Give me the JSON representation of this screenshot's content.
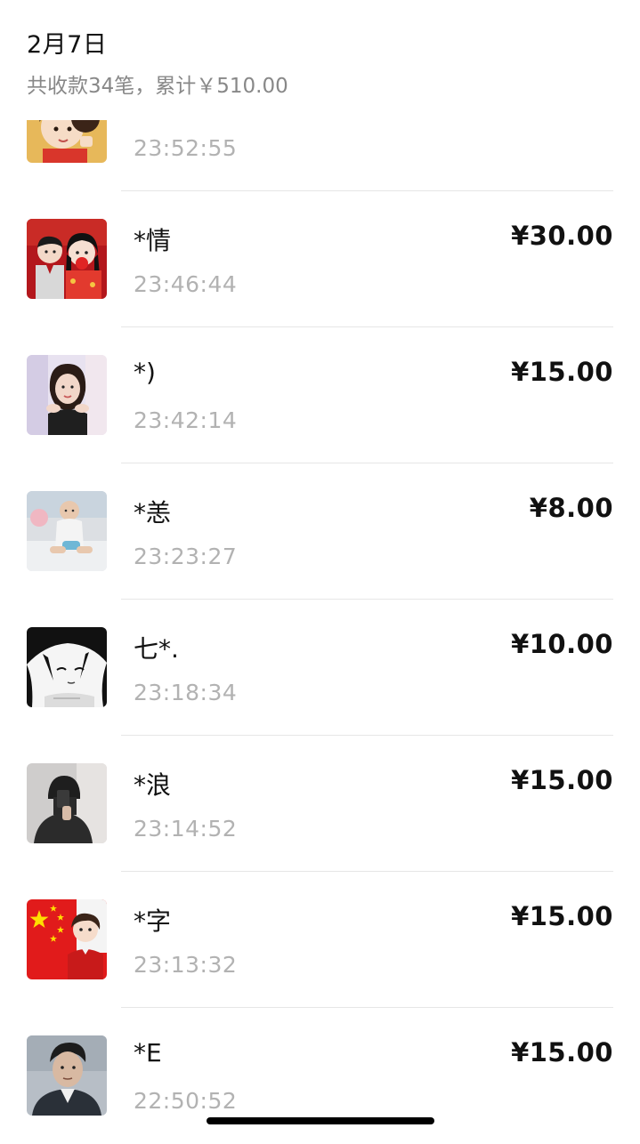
{
  "header": {
    "date": "2月7日",
    "summary": "共收款34笔，累计￥510.00"
  },
  "transactions": [
    {
      "name": "",
      "time": "23:52:55",
      "amount": "",
      "avatar": "cartoon-girl-avatar"
    },
    {
      "name": "*情",
      "time": "23:46:44",
      "amount": "¥30.00",
      "avatar": "wedding-couple-avatar"
    },
    {
      "name": "*)",
      "time": "23:42:14",
      "amount": "¥15.00",
      "avatar": "woman-portrait-avatar"
    },
    {
      "name": "*恙",
      "time": "23:23:27",
      "amount": "¥8.00",
      "avatar": "baby-photo-avatar"
    },
    {
      "name": "七*.",
      "time": "23:18:34",
      "amount": "¥10.00",
      "avatar": "manga-girl-avatar"
    },
    {
      "name": "*浪",
      "time": "23:14:52",
      "amount": "¥15.00",
      "avatar": "hooded-man-avatar"
    },
    {
      "name": "*字",
      "time": "23:13:32",
      "amount": "¥15.00",
      "avatar": "flag-cartoon-avatar"
    },
    {
      "name": "*E",
      "time": "22:50:52",
      "amount": "¥15.00",
      "avatar": "man-portrait-avatar"
    }
  ],
  "colors": {
    "primary_text": "#111111",
    "secondary_text": "#888888",
    "time_text": "#b2b2b2",
    "divider": "#e6e6e6"
  }
}
